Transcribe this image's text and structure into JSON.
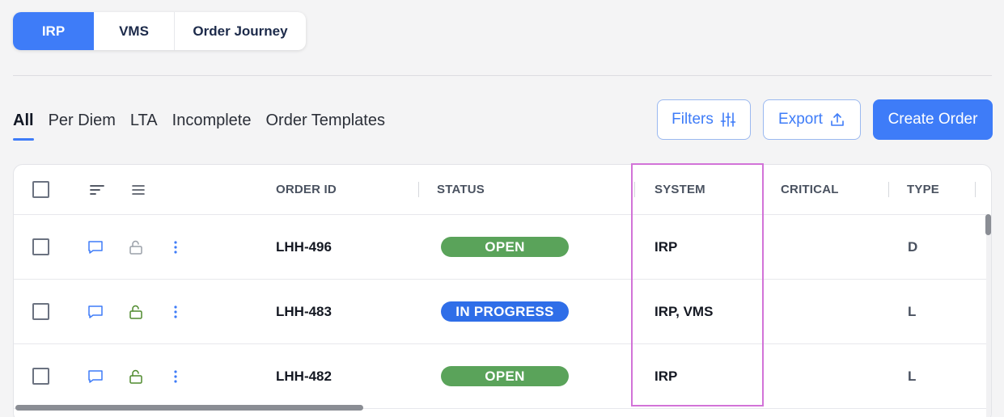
{
  "segmented": {
    "items": [
      {
        "label": "IRP",
        "active": true
      },
      {
        "label": "VMS",
        "active": false
      },
      {
        "label": "Order Journey",
        "active": false
      }
    ]
  },
  "tabs": [
    {
      "label": "All",
      "active": true
    },
    {
      "label": "Per Diem",
      "active": false
    },
    {
      "label": "LTA",
      "active": false
    },
    {
      "label": "Incomplete",
      "active": false
    },
    {
      "label": "Order Templates",
      "active": false
    }
  ],
  "actions": {
    "filters_label": "Filters",
    "export_label": "Export",
    "create_label": "Create Order"
  },
  "table": {
    "columns": {
      "order_id": "ORDER ID",
      "status": "STATUS",
      "system": "SYSTEM",
      "critical": "CRITICAL",
      "type": "TYPE"
    },
    "rows": [
      {
        "order_id": "LHH-496",
        "status": "OPEN",
        "status_color": "#5aa35a",
        "system": "IRP",
        "critical": "",
        "type": "D",
        "lock_color": "#9aa0a8"
      },
      {
        "order_id": "LHH-483",
        "status": "IN PROGRESS",
        "status_color": "#2f6ee8",
        "system": "IRP, VMS",
        "critical": "",
        "type": "L",
        "lock_color": "#4f8a2d"
      },
      {
        "order_id": "LHH-482",
        "status": "OPEN",
        "status_color": "#5aa35a",
        "system": "IRP",
        "critical": "",
        "type": "L",
        "lock_color": "#4f8a2d"
      }
    ]
  },
  "icons": {
    "filters": "sliders-icon",
    "export": "upload-icon",
    "row_comment": "comment-icon",
    "row_lock": "unlock-icon",
    "row_menu": "kebab-menu-icon",
    "header_sort": "sort-icon",
    "header_menu": "hamburger-icon"
  },
  "colors": {
    "accent": "#3e7cf8",
    "highlight": "#d273d8"
  }
}
